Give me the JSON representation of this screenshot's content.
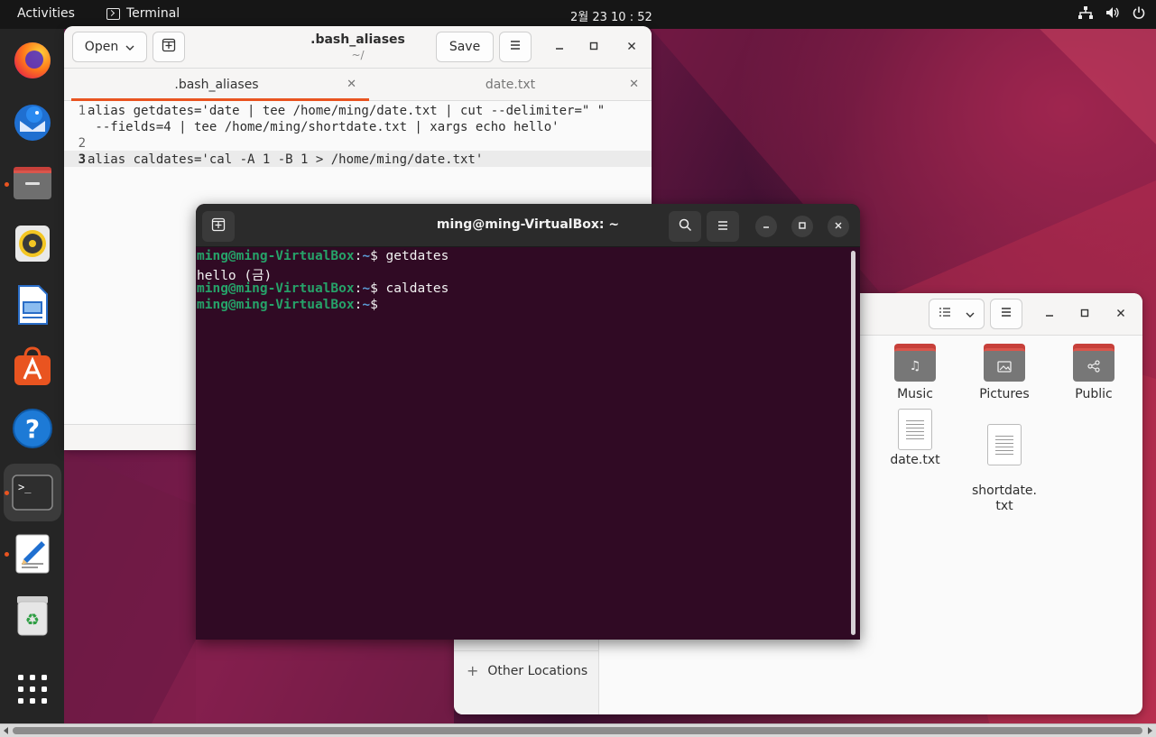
{
  "topbar": {
    "activities": "Activities",
    "app_name": "Terminal",
    "clock": "2월 23  10 : 52"
  },
  "dock": {
    "items": [
      "firefox",
      "thunderbird",
      "files",
      "rhythmbox",
      "libreoffice-writer",
      "app-center",
      "help",
      "terminal",
      "text-editor",
      "trash",
      "show-apps"
    ]
  },
  "gedit": {
    "open_label": "Open",
    "title": ".bash_aliases",
    "subtitle": "~/",
    "save_label": "Save",
    "tabs": [
      {
        "label": ".bash_aliases"
      },
      {
        "label": "date.txt"
      }
    ],
    "lines": [
      {
        "num": "1",
        "text": "alias getdates='date | tee /home/ming/date.txt | cut --delimiter=\" \""
      },
      {
        "num": "",
        "text": " --fields=4 | tee /home/ming/shortdate.txt | xargs echo hello'"
      },
      {
        "num": "2",
        "text": ""
      },
      {
        "num": "3",
        "text": "alias caldates='cal -A 1 -B 1 > /home/ming/date.txt'"
      }
    ]
  },
  "files": {
    "sidebar_other": "Other Locations",
    "items": [
      {
        "label": "Music",
        "type": "folder",
        "icon": "music-note-icon"
      },
      {
        "label": "Pictures",
        "type": "folder",
        "icon": "picture-icon"
      },
      {
        "label": "Public",
        "type": "folder",
        "icon": "share-icon"
      },
      {
        "label": "date.txt",
        "type": "file",
        "icon": "text-file-icon"
      },
      {
        "label": "shortdate.\ntxt",
        "type": "file",
        "icon": "text-file-icon"
      }
    ]
  },
  "terminal": {
    "title": "ming@ming-VirtualBox: ~",
    "prompt_user": "ming@ming-VirtualBox",
    "prompt_path": "~",
    "lines": [
      {
        "kind": "prompt",
        "cmd": "getdates"
      },
      {
        "kind": "output",
        "text": "hello (금)"
      },
      {
        "kind": "prompt",
        "cmd": "caldates"
      },
      {
        "kind": "prompt",
        "cmd": ""
      }
    ]
  },
  "colors": {
    "accent": "#e95420",
    "terminal_bg": "#300a24",
    "prompt_user": "#26a269",
    "prompt_path": "#5b9bd5"
  }
}
